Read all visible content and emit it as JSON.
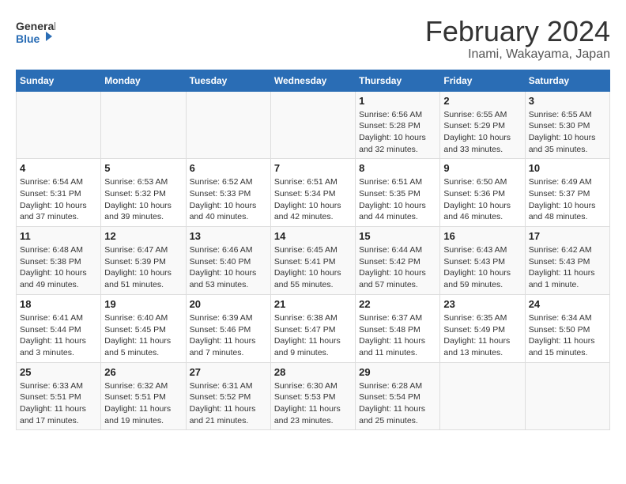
{
  "header": {
    "logo_line1": "General",
    "logo_line2": "Blue",
    "title": "February 2024",
    "subtitle": "Inami, Wakayama, Japan"
  },
  "columns": [
    "Sunday",
    "Monday",
    "Tuesday",
    "Wednesday",
    "Thursday",
    "Friday",
    "Saturday"
  ],
  "weeks": [
    [
      {
        "day": "",
        "info": ""
      },
      {
        "day": "",
        "info": ""
      },
      {
        "day": "",
        "info": ""
      },
      {
        "day": "",
        "info": ""
      },
      {
        "day": "1",
        "info": "Sunrise: 6:56 AM\nSunset: 5:28 PM\nDaylight: 10 hours\nand 32 minutes."
      },
      {
        "day": "2",
        "info": "Sunrise: 6:55 AM\nSunset: 5:29 PM\nDaylight: 10 hours\nand 33 minutes."
      },
      {
        "day": "3",
        "info": "Sunrise: 6:55 AM\nSunset: 5:30 PM\nDaylight: 10 hours\nand 35 minutes."
      }
    ],
    [
      {
        "day": "4",
        "info": "Sunrise: 6:54 AM\nSunset: 5:31 PM\nDaylight: 10 hours\nand 37 minutes."
      },
      {
        "day": "5",
        "info": "Sunrise: 6:53 AM\nSunset: 5:32 PM\nDaylight: 10 hours\nand 39 minutes."
      },
      {
        "day": "6",
        "info": "Sunrise: 6:52 AM\nSunset: 5:33 PM\nDaylight: 10 hours\nand 40 minutes."
      },
      {
        "day": "7",
        "info": "Sunrise: 6:51 AM\nSunset: 5:34 PM\nDaylight: 10 hours\nand 42 minutes."
      },
      {
        "day": "8",
        "info": "Sunrise: 6:51 AM\nSunset: 5:35 PM\nDaylight: 10 hours\nand 44 minutes."
      },
      {
        "day": "9",
        "info": "Sunrise: 6:50 AM\nSunset: 5:36 PM\nDaylight: 10 hours\nand 46 minutes."
      },
      {
        "day": "10",
        "info": "Sunrise: 6:49 AM\nSunset: 5:37 PM\nDaylight: 10 hours\nand 48 minutes."
      }
    ],
    [
      {
        "day": "11",
        "info": "Sunrise: 6:48 AM\nSunset: 5:38 PM\nDaylight: 10 hours\nand 49 minutes."
      },
      {
        "day": "12",
        "info": "Sunrise: 6:47 AM\nSunset: 5:39 PM\nDaylight: 10 hours\nand 51 minutes."
      },
      {
        "day": "13",
        "info": "Sunrise: 6:46 AM\nSunset: 5:40 PM\nDaylight: 10 hours\nand 53 minutes."
      },
      {
        "day": "14",
        "info": "Sunrise: 6:45 AM\nSunset: 5:41 PM\nDaylight: 10 hours\nand 55 minutes."
      },
      {
        "day": "15",
        "info": "Sunrise: 6:44 AM\nSunset: 5:42 PM\nDaylight: 10 hours\nand 57 minutes."
      },
      {
        "day": "16",
        "info": "Sunrise: 6:43 AM\nSunset: 5:43 PM\nDaylight: 10 hours\nand 59 minutes."
      },
      {
        "day": "17",
        "info": "Sunrise: 6:42 AM\nSunset: 5:43 PM\nDaylight: 11 hours\nand 1 minute."
      }
    ],
    [
      {
        "day": "18",
        "info": "Sunrise: 6:41 AM\nSunset: 5:44 PM\nDaylight: 11 hours\nand 3 minutes."
      },
      {
        "day": "19",
        "info": "Sunrise: 6:40 AM\nSunset: 5:45 PM\nDaylight: 11 hours\nand 5 minutes."
      },
      {
        "day": "20",
        "info": "Sunrise: 6:39 AM\nSunset: 5:46 PM\nDaylight: 11 hours\nand 7 minutes."
      },
      {
        "day": "21",
        "info": "Sunrise: 6:38 AM\nSunset: 5:47 PM\nDaylight: 11 hours\nand 9 minutes."
      },
      {
        "day": "22",
        "info": "Sunrise: 6:37 AM\nSunset: 5:48 PM\nDaylight: 11 hours\nand 11 minutes."
      },
      {
        "day": "23",
        "info": "Sunrise: 6:35 AM\nSunset: 5:49 PM\nDaylight: 11 hours\nand 13 minutes."
      },
      {
        "day": "24",
        "info": "Sunrise: 6:34 AM\nSunset: 5:50 PM\nDaylight: 11 hours\nand 15 minutes."
      }
    ],
    [
      {
        "day": "25",
        "info": "Sunrise: 6:33 AM\nSunset: 5:51 PM\nDaylight: 11 hours\nand 17 minutes."
      },
      {
        "day": "26",
        "info": "Sunrise: 6:32 AM\nSunset: 5:51 PM\nDaylight: 11 hours\nand 19 minutes."
      },
      {
        "day": "27",
        "info": "Sunrise: 6:31 AM\nSunset: 5:52 PM\nDaylight: 11 hours\nand 21 minutes."
      },
      {
        "day": "28",
        "info": "Sunrise: 6:30 AM\nSunset: 5:53 PM\nDaylight: 11 hours\nand 23 minutes."
      },
      {
        "day": "29",
        "info": "Sunrise: 6:28 AM\nSunset: 5:54 PM\nDaylight: 11 hours\nand 25 minutes."
      },
      {
        "day": "",
        "info": ""
      },
      {
        "day": "",
        "info": ""
      }
    ]
  ]
}
